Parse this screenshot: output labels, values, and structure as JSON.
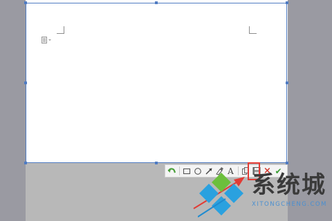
{
  "app": {
    "title": "",
    "colors": {
      "background": "#a8a8ae",
      "page": "#ffffff",
      "selection_border": "#4f7bc2",
      "highlight": "#e23b34",
      "toolbar": "#f4f4f4"
    }
  },
  "capture_toolbar": {
    "tools": [
      {
        "name": "undo-icon",
        "label": ""
      },
      {
        "name": "rectangle-icon",
        "label": ""
      },
      {
        "name": "ellipse-icon",
        "label": ""
      },
      {
        "name": "arrow-icon",
        "label": ""
      },
      {
        "name": "brush-icon",
        "label": ""
      },
      {
        "name": "text-icon",
        "label": "A"
      },
      {
        "name": "copy-icon",
        "label": ""
      },
      {
        "name": "save-icon",
        "label": ""
      },
      {
        "name": "cancel-icon",
        "label": "×"
      },
      {
        "name": "confirm-icon",
        "label": "✔"
      }
    ],
    "highlighted_tool": "save-icon"
  },
  "watermark": {
    "title": "系统城",
    "subtitle": "XITONGCHENG.COM"
  }
}
